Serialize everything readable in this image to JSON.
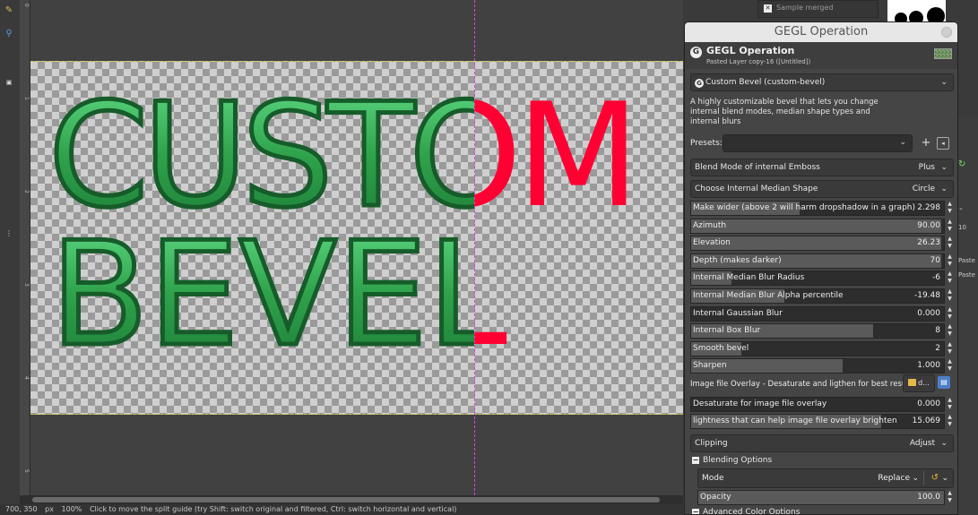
{
  "canvas": {
    "art_text_line1": "CUSTOM",
    "art_text_line2": "BEVEL",
    "ruler_ticks": [
      "0",
      "1",
      "2",
      "3",
      "4",
      "5"
    ]
  },
  "status": {
    "coords": "700, 350",
    "unit": "px",
    "zoom": "100%",
    "message": "Click to move the split guide (try Shift: switch original and filtered, Ctrl: switch horizontal and vertical)"
  },
  "dock": {
    "sample_merged": "Sample merged",
    "right_labels": [
      "Paste",
      "Paste"
    ],
    "right_number": "10"
  },
  "dialog": {
    "title": "GEGL Operation",
    "header_title": "GEGL Operation",
    "header_subtitle": "Pasted Layer copy-16 ([Untitled])",
    "operation": "Custom Bevel (custom-bevel)",
    "description": "A highly customizable bevel that lets you change internal blend modes, median shape types and internal blurs",
    "presets_label": "Presets:",
    "combos": [
      {
        "label": "Blend Mode of internal Emboss",
        "value": "Plus"
      },
      {
        "label": "Choose Internal Median Shape",
        "value": "Circle"
      }
    ],
    "sliders": [
      {
        "label": "Make wider (above 2 will harm dropshadow in a graph)",
        "value": "2.298",
        "fill": 0.43
      },
      {
        "label": "Azimuth",
        "value": "90.00",
        "fill": 0.99
      },
      {
        "label": "Elevation",
        "value": "26.23",
        "fill": 0.99
      },
      {
        "label": "Depth (makes darker)",
        "value": "70",
        "fill": 0.99
      },
      {
        "label": "Internal Median Blur Radius",
        "value": "-6",
        "fill": 0.16
      },
      {
        "label": "Internal Median Blur Alpha percentile",
        "value": "-19.48",
        "fill": 0.37
      },
      {
        "label": "Internal Gaussian Blur",
        "value": "0.000",
        "fill": 0.0
      },
      {
        "label": "Internal Box Blur",
        "value": "8",
        "fill": 0.72
      },
      {
        "label": "Smooth bevel",
        "value": "2",
        "fill": 0.2
      },
      {
        "label": "Sharpen",
        "value": "1.000",
        "fill": 0.6
      }
    ],
    "file_overlay_label": "Image file Overlay - Desaturate and ligthen for best results",
    "file_button": "d...",
    "desaturate": {
      "label": "Desaturate for image file overlay",
      "value": "0.000",
      "fill": 0.0
    },
    "lightness": {
      "label": "lightness that can help image file overlay brighten",
      "value": "15.069",
      "fill": 0.75
    },
    "clipping": {
      "label": "Clipping",
      "value": "Adjust"
    },
    "blending_options": "Blending Options",
    "mode": {
      "label": "Mode",
      "value": "Replace"
    },
    "opacity": {
      "label": "Opacity",
      "value": "100.0",
      "fill": 1.0
    },
    "advanced_color": "Advanced Color Options"
  },
  "colors": {
    "green_text": "#2fa24b",
    "red_text": "#ff0033",
    "guide": "#d04ad0"
  }
}
